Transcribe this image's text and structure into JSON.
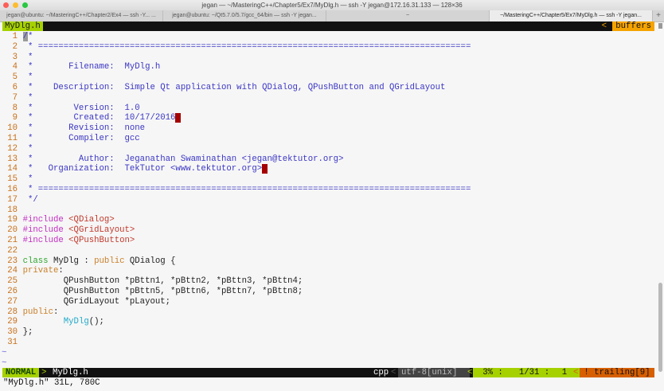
{
  "window": {
    "title": "jegan — ~/MasteringC++/Chapter5/Ex7/MyDlg.h — ssh -Y jegan@172.16.31.133 — 128×36"
  },
  "tabs": [
    {
      "label": "jegan@ubuntu: ~/MasteringC++/Chapter2/Ex4 — ssh -Y...   ..."
    },
    {
      "label": "jegan@ubuntu: ~/Qt5.7.0/5.7/gcc_64/bin — ssh -Y jegan..."
    },
    {
      "label": "~"
    },
    {
      "label": "~/MasteringC++/Chapter5/Ex7/MyDlg.h — ssh -Y jegan..."
    }
  ],
  "tabline": {
    "buffer": "MyDlg.h",
    "arrow": "<",
    "right_label": "buffers"
  },
  "lines": [
    [
      [
        "/",
        "cur"
      ],
      [
        "*",
        "cm"
      ]
    ],
    [
      [
        " * =====================================================================================",
        "cm"
      ]
    ],
    [
      [
        " *",
        "cm"
      ]
    ],
    [
      [
        " *       Filename:  MyDlg.h",
        "cm"
      ]
    ],
    [
      [
        " *",
        "cm"
      ]
    ],
    [
      [
        " *    Description:  Simple Qt application with QDialog, QPushButton and QGridLayout",
        "cm"
      ]
    ],
    [
      [
        " *",
        "cm"
      ]
    ],
    [
      [
        " *        Version:  1.0",
        "cm"
      ]
    ],
    [
      [
        " *        Created:  10/17/2016",
        "cm"
      ],
      [
        " ",
        "tw"
      ]
    ],
    [
      [
        " *       Revision:  none",
        "cm"
      ]
    ],
    [
      [
        " *       Compiler:  gcc",
        "cm"
      ]
    ],
    [
      [
        " *",
        "cm"
      ]
    ],
    [
      [
        " *         Author:  Jeganathan Swaminathan <jegan@tektutor.org>",
        "cm"
      ]
    ],
    [
      [
        " *   Organization:  TekTutor <www.tektutor.org>",
        "cm"
      ],
      [
        " ",
        "tw"
      ]
    ],
    [
      [
        " *",
        "cm"
      ]
    ],
    [
      [
        " * =====================================================================================",
        "cm"
      ]
    ],
    [
      [
        " */",
        "cm"
      ]
    ],
    [],
    [
      [
        "#include ",
        "pp"
      ],
      [
        "<QDialog>",
        "st"
      ]
    ],
    [
      [
        "#include ",
        "pp"
      ],
      [
        "<QGridLayout>",
        "st"
      ]
    ],
    [
      [
        "#include ",
        "pp"
      ],
      [
        "<QPushButton>",
        "st"
      ]
    ],
    [],
    [
      [
        "class ",
        "kw"
      ],
      [
        "MyDlg : ",
        "tx"
      ],
      [
        "public ",
        "ac"
      ],
      [
        "QDialog {",
        "tx"
      ]
    ],
    [
      [
        "private",
        "ac"
      ],
      [
        ":",
        "tx"
      ]
    ],
    [
      [
        "        QPushButton *pBttn1, *pBttn2, *pBttn3, *pBttn4;",
        "tx"
      ]
    ],
    [
      [
        "        QPushButton *pBttn5, *pBttn6, *pBttn7, *pBttn8;",
        "tx"
      ]
    ],
    [
      [
        "        QGridLayout *pLayout;",
        "tx"
      ]
    ],
    [
      [
        "public",
        "ac"
      ],
      [
        ":",
        "tx"
      ]
    ],
    [
      [
        "        ",
        "tx"
      ],
      [
        "MyDlg",
        "fn"
      ],
      [
        "();",
        "tx"
      ]
    ],
    [
      [
        "};",
        "tx"
      ]
    ],
    []
  ],
  "tilde": "~",
  "statusline": {
    "mode": "NORMAL",
    "sep1": ">",
    "filename": "MyDlg.h",
    "filetype": "cpp",
    "sep2": "<",
    "encoding": "utf-8[unix]",
    "sep3": "<",
    "percent": "3% :",
    "position": "1/31 :",
    "column": "1",
    "sep4": "<",
    "warning": "! trailing[9]"
  },
  "cmdline": "\"MyDlg.h\" 31L, 780C",
  "colors": {
    "mode_bg": "#a6d100",
    "buffers_bg": "#f5a300",
    "warning_bg": "#d75f00",
    "comment": "#3b36c4"
  }
}
